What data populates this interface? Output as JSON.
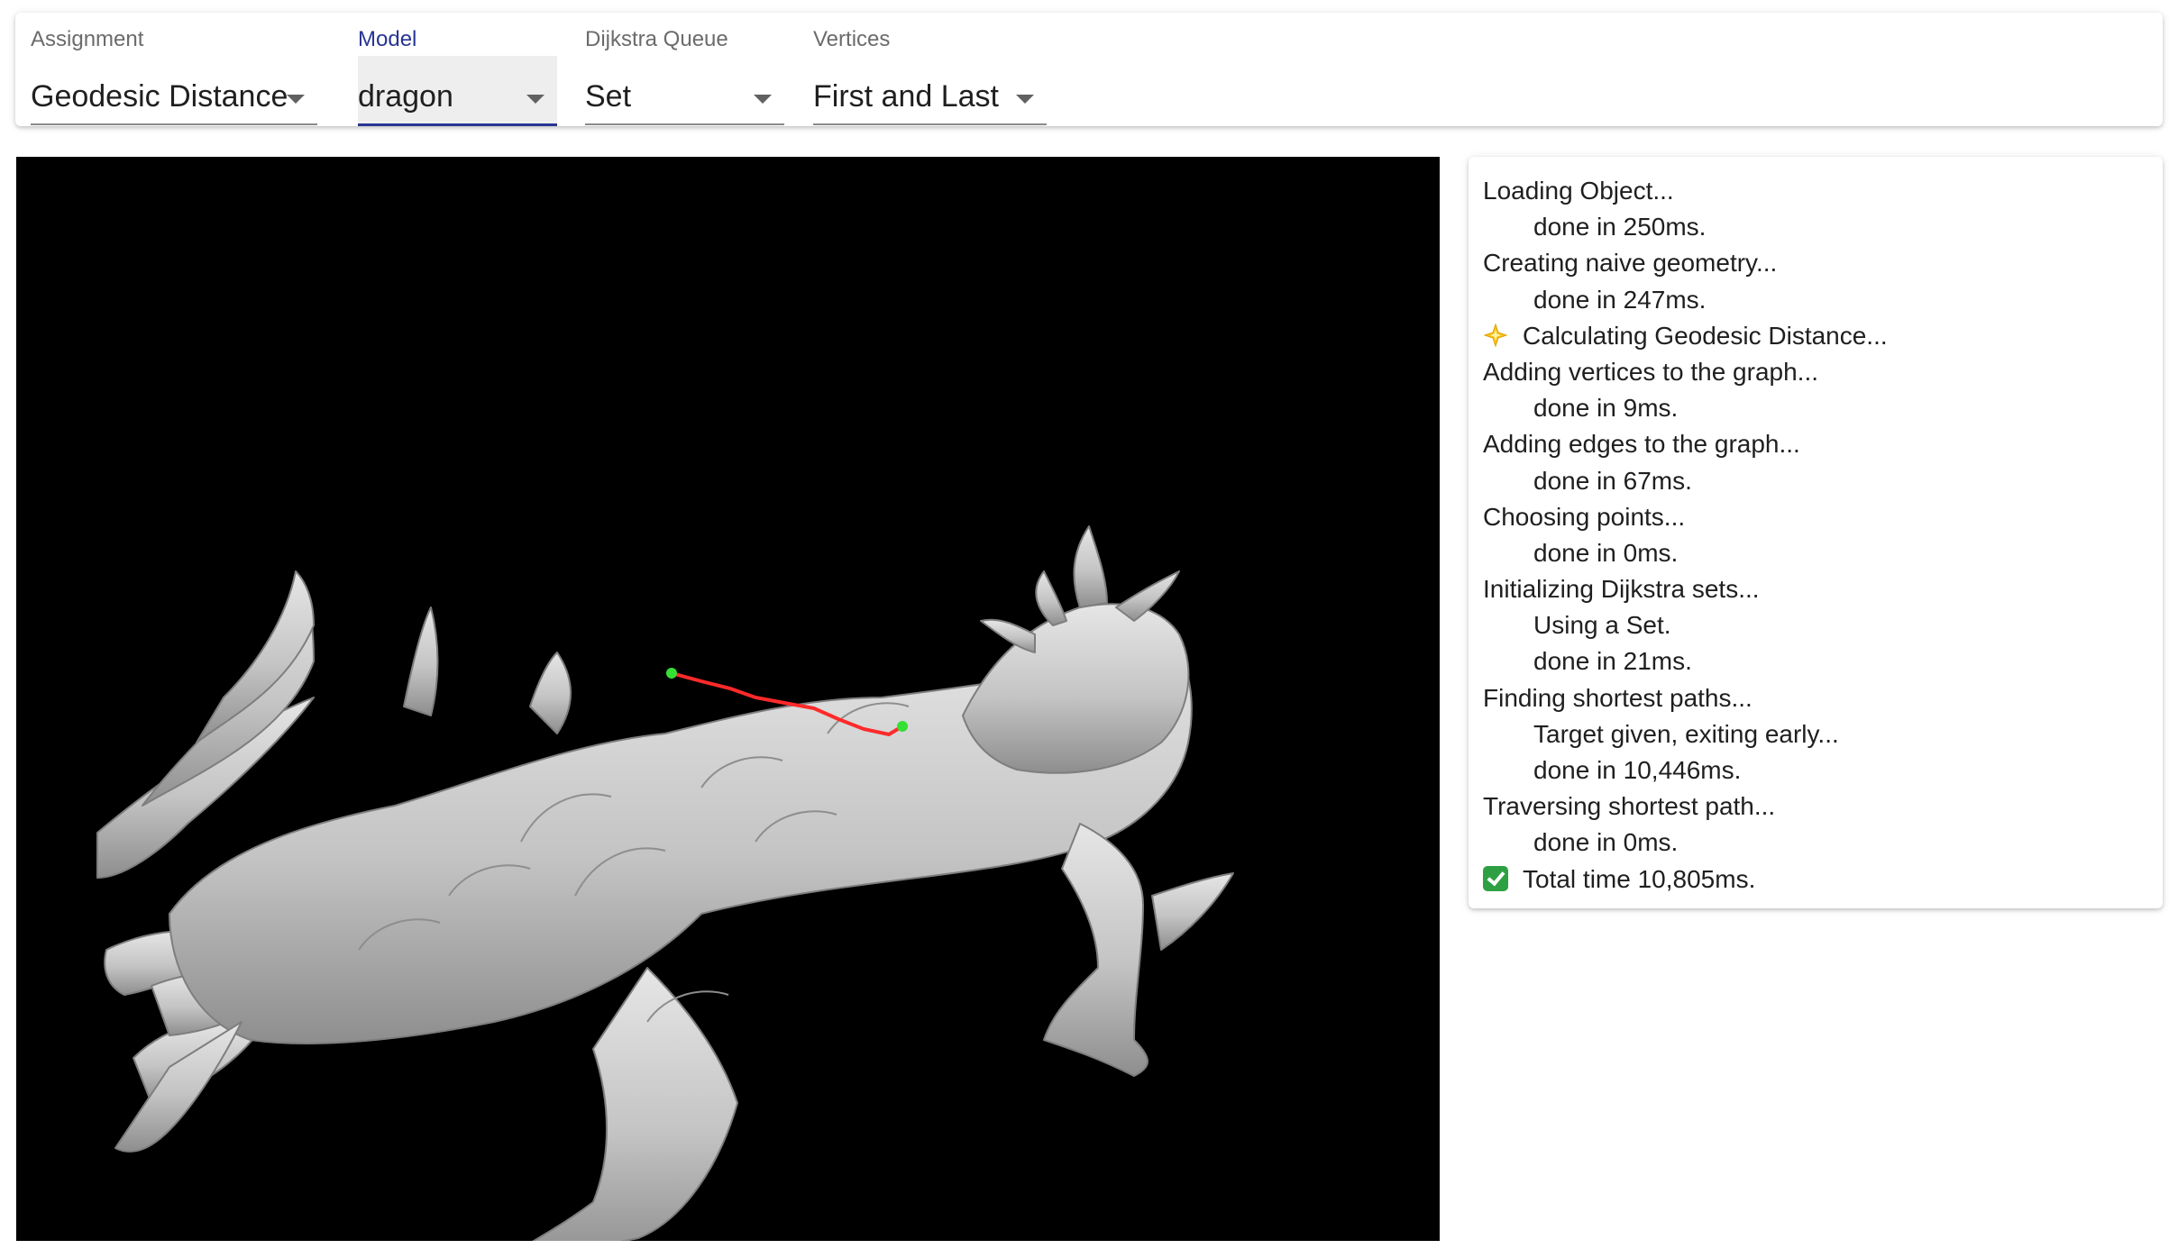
{
  "toolbar": {
    "assignment": {
      "label": "Assignment",
      "value": "Geodesic Distance"
    },
    "model": {
      "label": "Model",
      "value": "dragon"
    },
    "queue": {
      "label": "Dijkstra Queue",
      "value": "Set"
    },
    "vertices": {
      "label": "Vertices",
      "value": "First and Last"
    }
  },
  "viewport": {
    "background": "#000000",
    "mesh_color": "#c8c8c8",
    "path_color": "#ff2a2a",
    "endpoint_color": "#35e035"
  },
  "log": {
    "lines": [
      {
        "text": "Loading Object...",
        "indent": false
      },
      {
        "text": "done in 250ms.",
        "indent": true
      },
      {
        "text": "Creating naive geometry...",
        "indent": false
      },
      {
        "text": "done in 247ms.",
        "indent": true
      },
      {
        "text": "Calculating Geodesic Distance...",
        "indent": false,
        "icon": "sparkle-icon"
      },
      {
        "text": "Adding vertices to the graph...",
        "indent": false
      },
      {
        "text": "done in 9ms.",
        "indent": true
      },
      {
        "text": "Adding edges to the graph...",
        "indent": false
      },
      {
        "text": "done in 67ms.",
        "indent": true
      },
      {
        "text": "Choosing points...",
        "indent": false
      },
      {
        "text": "done in 0ms.",
        "indent": true
      },
      {
        "text": "Initializing Dijkstra sets...",
        "indent": false
      },
      {
        "text": "Using a Set.",
        "indent": true
      },
      {
        "text": "done in 21ms.",
        "indent": true
      },
      {
        "text": "Finding shortest paths...",
        "indent": false
      },
      {
        "text": "Target given, exiting early...",
        "indent": true
      },
      {
        "text": "done in 10,446ms.",
        "indent": true
      },
      {
        "text": "Traversing shortest path...",
        "indent": false
      },
      {
        "text": "done in 0ms.",
        "indent": true
      },
      {
        "text": "Total time 10,805ms.",
        "indent": false,
        "icon": "check-icon"
      }
    ]
  }
}
